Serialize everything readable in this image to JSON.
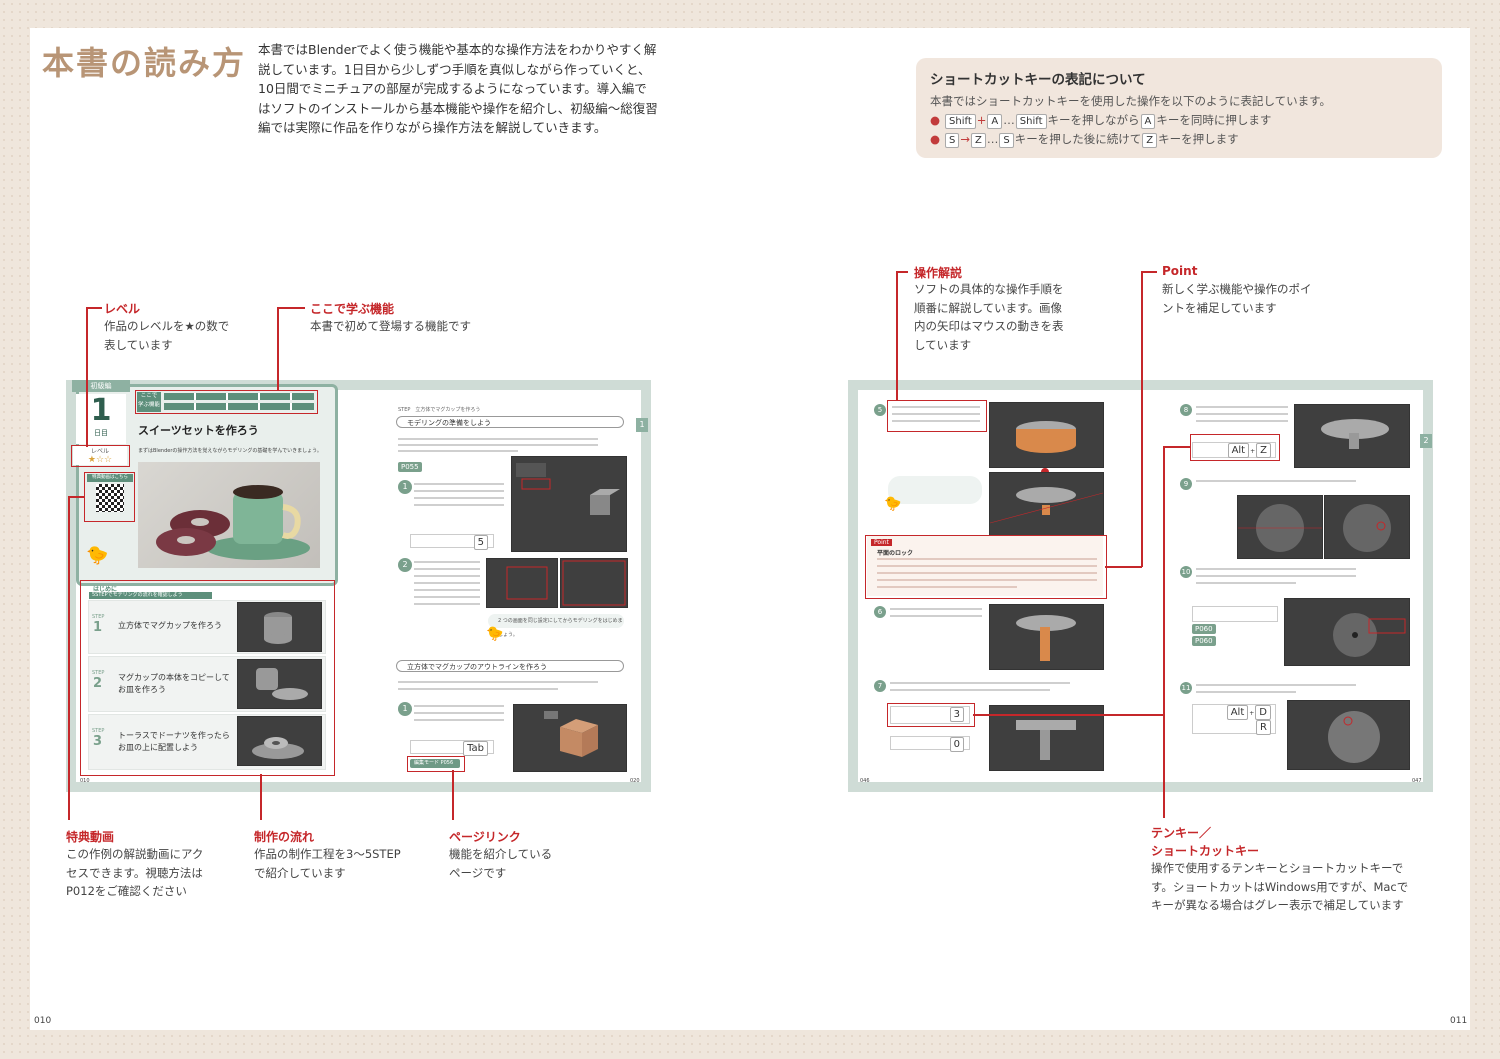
{
  "header": {
    "title": "本書の読み方",
    "intro": "本書ではBlenderでよく使う機能や基本的な操作方法をわかりやすく解説しています。1日目から少しずつ手順を真似しながら作っていくと、10日間でミニチュアの部屋が完成するようになっています。導入編ではソフトのインストールから基本機能や操作を紹介し、初級編〜総復習編では実際に作品を作りながら操作方法を解説していきます。"
  },
  "shortcut_box": {
    "heading": "ショートカットキーの表記について",
    "desc": "本書ではショートカットキーを使用した操作を以下のように表記しています。",
    "ex1": {
      "k1": "Shift",
      "op": "+",
      "k2": "A",
      "sep": "…",
      "k3": "Shift",
      "mid": "キーを押しながら",
      "k4": "A",
      "end": "キーを同時に押します"
    },
    "ex2": {
      "k1": "S",
      "op": "→",
      "k2": "Z",
      "sep": "…",
      "k3": "S",
      "mid": "キーを押した後に続けて",
      "k4": "Z",
      "end": "キーを押します"
    }
  },
  "callouts": {
    "level": {
      "label": "レベル",
      "desc": "作品のレベルを★の数で\n表しています"
    },
    "features": {
      "label": "ここで学ぶ機能",
      "desc": "本書で初めて登場する機能です"
    },
    "video": {
      "label": "特典動画",
      "desc": "この作例の解説動画にアク\nセスできます。視聴方法は\nP012をご確認ください"
    },
    "flow": {
      "label": "制作の流れ",
      "desc": "作品の制作工程を3〜5STEP\nで紹介しています"
    },
    "pagelink": {
      "label": "ページリンク",
      "desc": "機能を紹介している\nページです"
    },
    "operation": {
      "label": "操作解説",
      "desc": "ソフトの具体的な操作手順を\n順番に解説しています。画像\n内の矢印はマウスの動きを表\nしています"
    },
    "point": {
      "label": "Point",
      "desc": "新しく学ぶ機能や操作のポイ\nントを補足しています"
    },
    "keys": {
      "label": "テンキー／\nショートカットキー",
      "desc": "操作で使用するテンキーとショートカットキーで\nす。ショートカットはWindows用ですが、Macで\nキーが異なる場合はグレー表示で補足しています"
    }
  },
  "sample_left": {
    "edition": "初級編",
    "day_number": "1",
    "day_label": "日目",
    "level_label": "レベル",
    "stars": "★☆☆",
    "features_tag": "ここで\n学ぶ機能",
    "chapter_title": "スイーツセットを作ろう",
    "lead": "まずはBlenderの操作方法を覚えながらモデリングの基礎を学んでいきましょう。",
    "video_label": "特典動画はこちら",
    "intro_label": "はじめに",
    "flow_banner": "5STEPでモデリングの流れを確認しよう",
    "steps": [
      {
        "no": "1",
        "text": "立方体でマグカップを作ろう"
      },
      {
        "no": "2",
        "text": "マグカップの本体をコピーして\nお皿を作ろう"
      },
      {
        "no": "3",
        "text": "トーラスでドーナツを作ったら\nお皿の上に配置しよう"
      }
    ],
    "step_word": "STEP",
    "col_step_heading": "立方体でマグカップを作ろう",
    "section1": "モデリングの準備をしよう",
    "section2": "立方体でマグカップのアウトラインを作ろう",
    "key_tab": "Tab",
    "key_5": "5",
    "pagelink_text": "編集モード P056",
    "folio_left": "010",
    "folio_right": "020",
    "side_number": "1"
  },
  "sample_right": {
    "point_tag": "Point",
    "point_title": "平面のロック",
    "key_alt": "Alt",
    "key_z": "Z",
    "key_3": "3",
    "key_0": "0",
    "key_d": "D",
    "key_r": "R",
    "side_number": "2",
    "folio_left": "046",
    "folio_right": "047"
  },
  "folios": {
    "left": "010",
    "right": "011"
  }
}
